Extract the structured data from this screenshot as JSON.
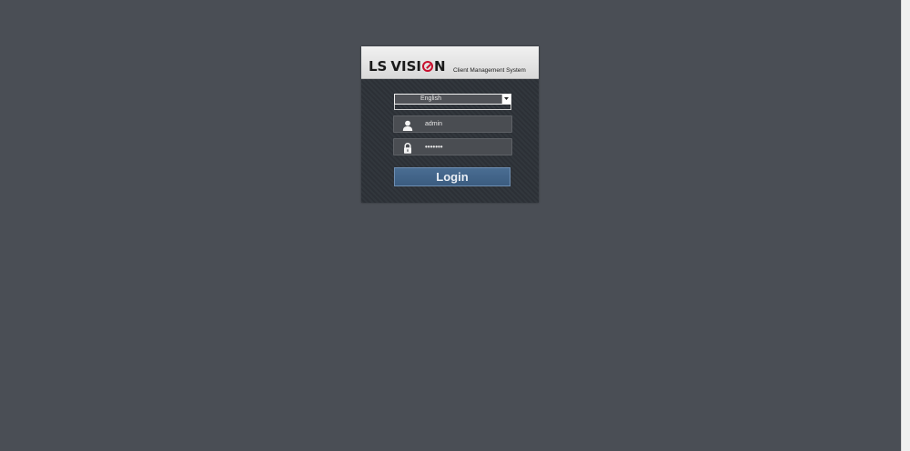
{
  "brand": {
    "logo_ls": "LS",
    "logo_visi": "VISI",
    "logo_n": "N",
    "subtitle": "Client Management System",
    "accent_color": "#c8102e"
  },
  "login": {
    "language": {
      "selected": "English"
    },
    "username": {
      "value": "admin",
      "icon": "user-icon"
    },
    "password": {
      "value": "•••••••",
      "icon": "lock-icon"
    },
    "login_button_label": "Login"
  },
  "colors": {
    "page_background": "#4a4e55",
    "panel_background": "#2d3238",
    "button_background": "#416488"
  }
}
